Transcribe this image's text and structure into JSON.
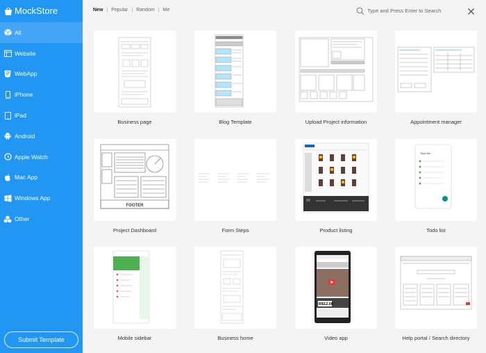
{
  "brand": {
    "name": "MockStore",
    "icon": "bag-icon"
  },
  "sidebar": {
    "items": [
      {
        "label": "All",
        "icon": "cube-icon",
        "active": true
      },
      {
        "label": "Website",
        "icon": "browser-icon"
      },
      {
        "label": "WebApp",
        "icon": "html5-icon"
      },
      {
        "label": "iPhone",
        "icon": "phone-icon"
      },
      {
        "label": "iPad",
        "icon": "tablet-icon"
      },
      {
        "label": "Android",
        "icon": "android-icon"
      },
      {
        "label": "Apple Watch",
        "icon": "watch-icon"
      },
      {
        "label": "Mac App",
        "icon": "apple-icon"
      },
      {
        "label": "Windows App",
        "icon": "windows-icon"
      },
      {
        "label": "Other",
        "icon": "cubes-icon"
      }
    ],
    "submit_label": "Submit Template"
  },
  "filters": {
    "items": [
      "New",
      "Popular",
      "Random",
      "Me"
    ],
    "active": "New"
  },
  "search": {
    "placeholder": "Type and Press Enter to Search"
  },
  "colors": {
    "sidebar": "#2196f3",
    "sidebar_active": "#42a5f5"
  },
  "templates": [
    {
      "title": "Business page"
    },
    {
      "title": "Blog Template"
    },
    {
      "title": "Upload Project information"
    },
    {
      "title": "Appointment manager"
    },
    {
      "title": "Project Dashboard",
      "footer_text": "FOOTER"
    },
    {
      "title": "Form Steps"
    },
    {
      "title": "Product listing"
    },
    {
      "title": "Todo list",
      "screen_title": "Todo list"
    },
    {
      "title": "Mobile sidebar"
    },
    {
      "title": "Business home"
    },
    {
      "title": "Video app",
      "price_tag": "R$12,00"
    },
    {
      "title": "Help portal / Search directory"
    }
  ]
}
